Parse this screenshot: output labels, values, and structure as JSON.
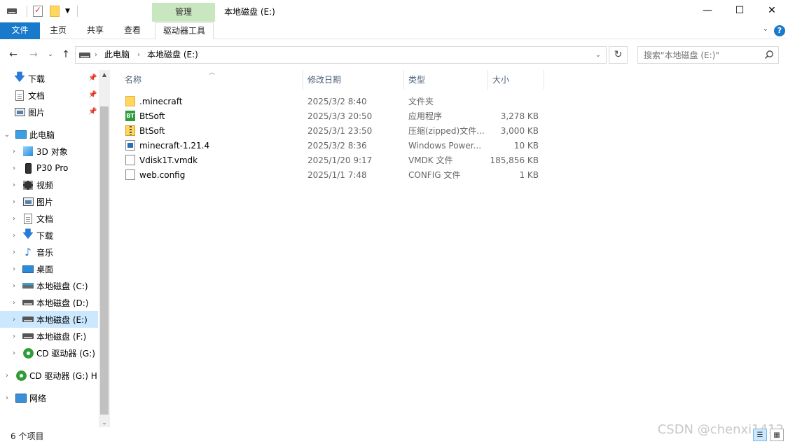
{
  "titlebar": {
    "manage_tab": "管理",
    "title": "本地磁盘 (E:)",
    "minimize": "—",
    "maximize": "☐",
    "close": "✕"
  },
  "ribbon": {
    "tabs": [
      "文件",
      "主页",
      "共享",
      "查看",
      "驱动器工具"
    ],
    "help": "?"
  },
  "address": {
    "crumbs": [
      "此电脑",
      "本地磁盘 (E:)"
    ],
    "search_placeholder": "搜索\"本地磁盘 (E:)\""
  },
  "sidebar": {
    "quick_access": [
      {
        "label": "下载",
        "icon": "download-icon"
      },
      {
        "label": "文档",
        "icon": "document-icon"
      },
      {
        "label": "图片",
        "icon": "picture-icon"
      }
    ],
    "this_pc": "此电脑",
    "pc_items": [
      {
        "label": "3D 对象",
        "icon": "3d-objects-icon"
      },
      {
        "label": "P30 Pro",
        "icon": "phone-icon"
      },
      {
        "label": "视频",
        "icon": "video-icon"
      },
      {
        "label": "图片",
        "icon": "picture-icon"
      },
      {
        "label": "文档",
        "icon": "document-icon"
      },
      {
        "label": "下载",
        "icon": "download-icon"
      },
      {
        "label": "音乐",
        "icon": "music-icon"
      },
      {
        "label": "桌面",
        "icon": "desktop-icon"
      },
      {
        "label": "本地磁盘 (C:)",
        "icon": "system-drive-icon"
      },
      {
        "label": "本地磁盘 (D:)",
        "icon": "drive-icon"
      },
      {
        "label": "本地磁盘 (E:)",
        "icon": "drive-icon",
        "selected": true
      },
      {
        "label": "本地磁盘 (F:)",
        "icon": "drive-icon"
      },
      {
        "label": "CD 驱动器 (G:)",
        "icon": "cd-drive-icon"
      }
    ],
    "cd_root": "CD 驱动器 (G:) H",
    "network": "网络"
  },
  "columns": {
    "name": "名称",
    "date": "修改日期",
    "type": "类型",
    "size": "大小"
  },
  "files": [
    {
      "name": ".minecraft",
      "date": "2025/3/2 8:40",
      "type": "文件夹",
      "size": "",
      "icon": "folder-icon"
    },
    {
      "name": "BtSoft",
      "date": "2025/3/3 20:50",
      "type": "应用程序",
      "size": "3,278 KB",
      "icon": "app-icon"
    },
    {
      "name": "BtSoft",
      "date": "2025/3/1 23:50",
      "type": "压缩(zipped)文件...",
      "size": "3,000 KB",
      "icon": "zip-icon"
    },
    {
      "name": "minecraft-1.21.4",
      "date": "2025/3/2 8:36",
      "type": "Windows Power...",
      "size": "10 KB",
      "icon": "powershell-icon"
    },
    {
      "name": "Vdisk1T.vmdk",
      "date": "2025/1/20 9:17",
      "type": "VMDK 文件",
      "size": "185,856 KB",
      "icon": "file-icon"
    },
    {
      "name": "web.config",
      "date": "2025/1/1 7:48",
      "type": "CONFIG 文件",
      "size": "1 KB",
      "icon": "file-icon"
    }
  ],
  "status": {
    "count": "6 个项目"
  },
  "watermark": "CSDN @chenxi1412"
}
